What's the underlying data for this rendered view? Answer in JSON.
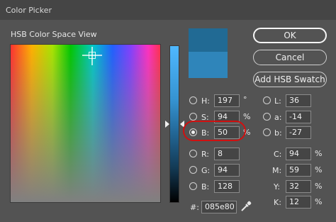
{
  "window": {
    "title": "Color Picker"
  },
  "field": {
    "label": "HSB Color Space View"
  },
  "buttons": {
    "ok": "OK",
    "cancel": "Cancel",
    "add_hsb": "Add HSB Swatch"
  },
  "colors": {
    "new": "#216a94",
    "current": "#2f85ba",
    "highlight": "#d01010"
  },
  "hsb": {
    "h": {
      "label": "H:",
      "value": "197",
      "unit": "°",
      "selected": false
    },
    "s": {
      "label": "S:",
      "value": "94",
      "unit": "%",
      "selected": false
    },
    "b": {
      "label": "B:",
      "value": "50",
      "unit": "%",
      "selected": true
    }
  },
  "rgb": {
    "r": {
      "label": "R:",
      "value": "8"
    },
    "g": {
      "label": "G:",
      "value": "94"
    },
    "b": {
      "label": "B:",
      "value": "128"
    }
  },
  "lab": {
    "l": {
      "label": "L:",
      "value": "36"
    },
    "a": {
      "label": "a:",
      "value": "-14"
    },
    "b": {
      "label": "b:",
      "value": "-27"
    }
  },
  "cmyk": {
    "c": {
      "label": "C:",
      "value": "94",
      "unit": "%"
    },
    "m": {
      "label": "M:",
      "value": "59",
      "unit": "%"
    },
    "y": {
      "label": "Y:",
      "value": "32",
      "unit": "%"
    },
    "k": {
      "label": "K:",
      "value": "12",
      "unit": "%"
    }
  },
  "hex": {
    "label": "#:",
    "value": "085e80"
  },
  "icons": {
    "eyedropper": "eyedropper-icon"
  }
}
